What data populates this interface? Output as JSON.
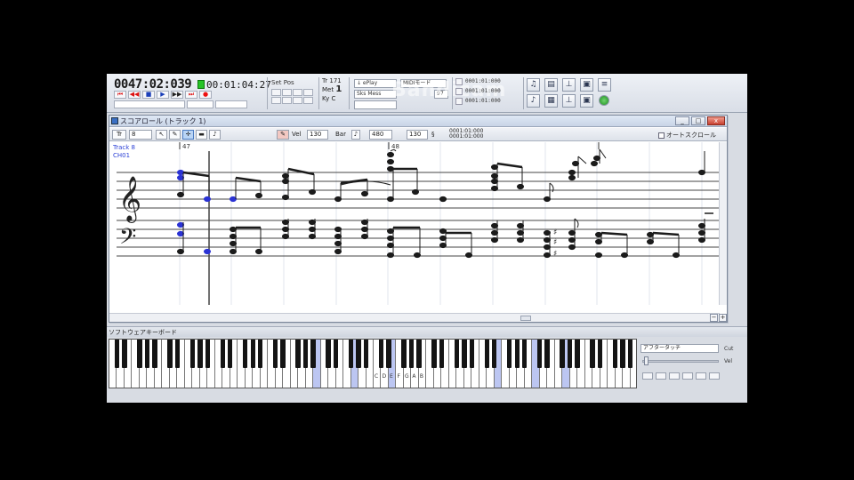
{
  "main_toolbar": {
    "counter": "0047:02:039",
    "time": "00:01:04:27",
    "transport_buttons": [
      "⏮",
      "◀◀",
      "■",
      "▶",
      "▶▶",
      "⏭"
    ],
    "setpos_label": "Set Pos",
    "tempo": {
      "tr_label": "Tr",
      "tr_value": "171",
      "meter_label": "Met",
      "meter_value": "1",
      "key_label": "Ky",
      "key_value": "C"
    },
    "play_mode": "↓ ePlay",
    "midi_mode": "MIDIモード",
    "song_mode": "Sks Mess",
    "volume_value": "97",
    "positions": [
      "0001:01:000",
      "0001:01:000",
      "0001:01:000"
    ],
    "watermark": "Bandicam"
  },
  "score_window": {
    "title": "スコアロール (トラック 1)",
    "window_buttons": {
      "minimize": "_",
      "maximize": "□",
      "close": "x"
    },
    "toolbar": {
      "track_prefix": "Tr",
      "track_value": "8",
      "vel_label": "Vel",
      "vel_value": "130",
      "gate_label": "Bar",
      "gate_value": "480",
      "step_value": "130",
      "pos_a": "0001:01:000",
      "pos_b": "0001:01:000",
      "auto_scroll": "オートスクロール"
    },
    "track_label_line1": "Track 8",
    "track_label_line2": "CH01",
    "measure_numbers": [
      "47",
      "48"
    ]
  },
  "keyboard": {
    "title": "ソフトウェアキーボード",
    "aftertouch": "アフタータッチ",
    "cut_label": "Cut",
    "vel_label": "Vel",
    "octave_labels": [
      "C",
      "D",
      "E",
      "F",
      "G",
      "A",
      "B"
    ]
  },
  "colors": {
    "selected_note": "#2b33d4",
    "keyboard_lit": "#bcc6f2"
  }
}
